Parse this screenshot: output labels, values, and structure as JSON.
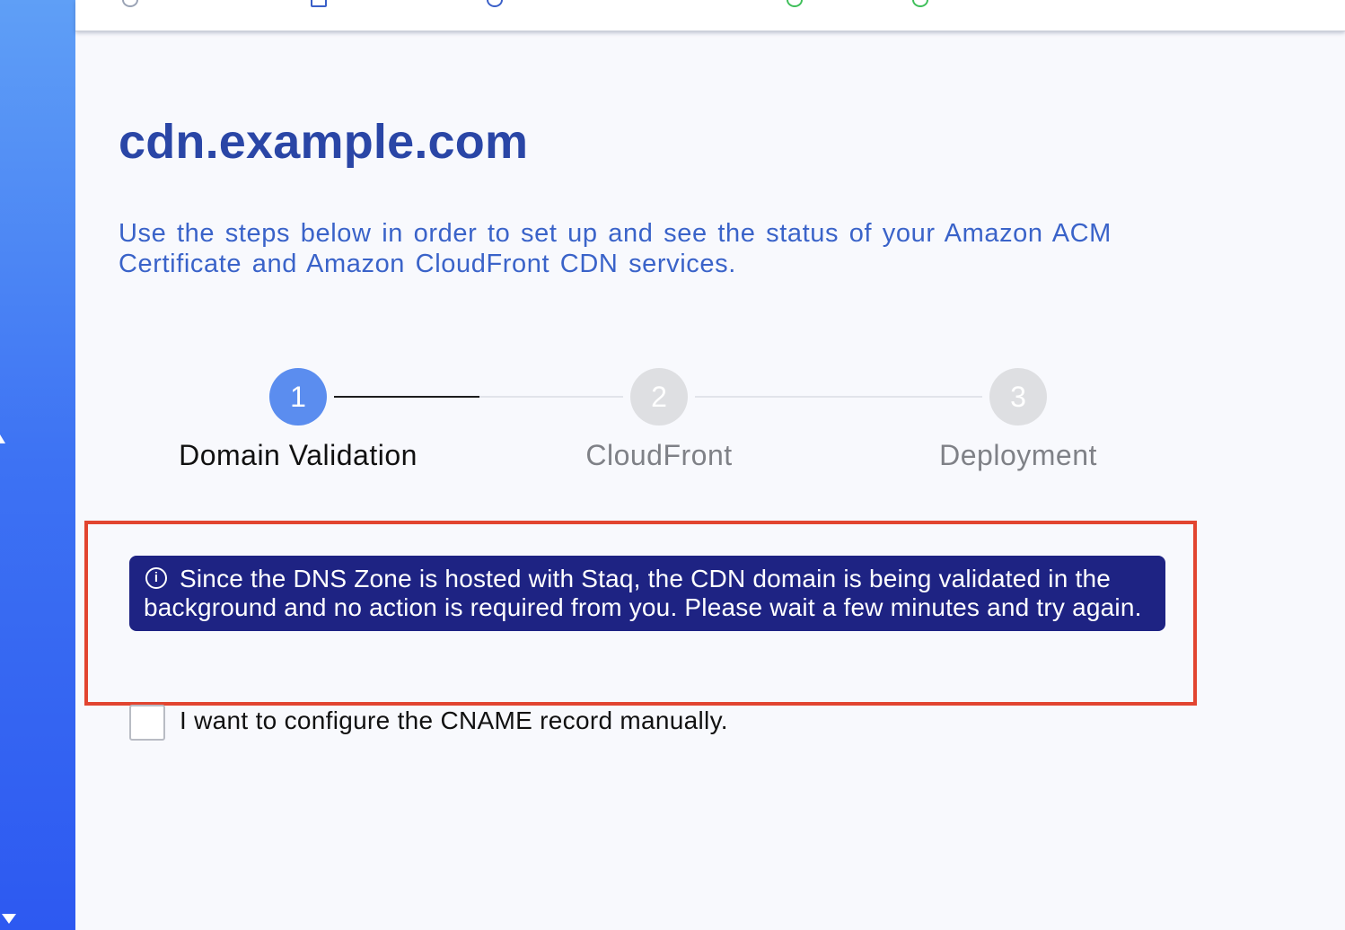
{
  "sidebar": {
    "scroll_up_icon": "triangle-up-icon",
    "scroll_down_icon": "triangle-down-icon"
  },
  "page": {
    "title": "cdn.example.com",
    "intro": "Use the steps below in order to set up and see the status of your Amazon ACM Certificate and Amazon CloudFront CDN services."
  },
  "stepper": {
    "steps": [
      {
        "number": "1",
        "label": "Domain Validation",
        "state": "active"
      },
      {
        "number": "2",
        "label": "CloudFront",
        "state": "inactive"
      },
      {
        "number": "3",
        "label": "Deployment",
        "state": "inactive"
      }
    ],
    "progress_fraction_step1_to_step2": 0.5
  },
  "alert": {
    "icon": "info-icon",
    "icon_glyph": "i",
    "message": "Since the DNS Zone is hosted with Staq, the CDN domain is being validated in the background and no action is required from you. Please wait a few minutes and try again."
  },
  "manual_cname": {
    "label": "I want to configure the CNAME record manually.",
    "checked": false
  },
  "colors": {
    "brand": "#2a46a6",
    "intro_text": "#3a63c9",
    "step_active": "#5b8def",
    "step_inactive": "#dedfe2",
    "alert_bg": "#1e2383",
    "highlight": "#e24530",
    "sidebar_top": "#5f9ff6",
    "sidebar_bottom": "#2d59f1"
  }
}
